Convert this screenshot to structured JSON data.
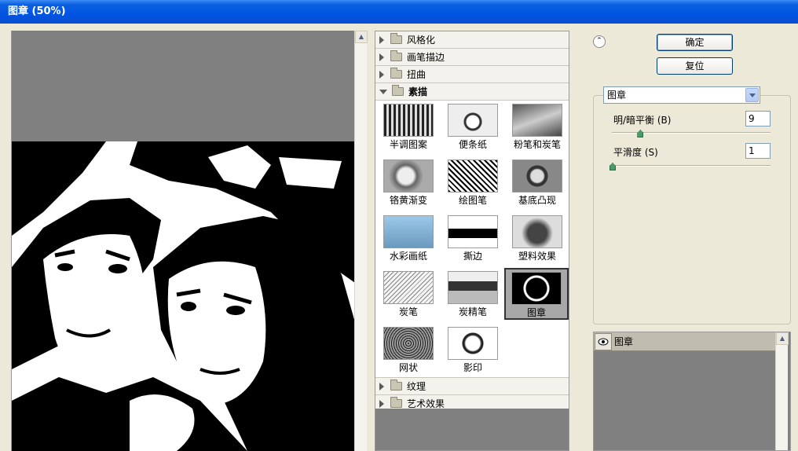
{
  "window": {
    "title": "图章 (50%)"
  },
  "buttons": {
    "ok": "确定",
    "reset": "复位"
  },
  "filter_categories_top": [
    {
      "label": "风格化",
      "expanded": false
    },
    {
      "label": "画笔描边",
      "expanded": false
    },
    {
      "label": "扭曲",
      "expanded": false
    },
    {
      "label": "素描",
      "expanded": true
    }
  ],
  "sketch_filters": [
    {
      "label": "半调图案"
    },
    {
      "label": "便条纸"
    },
    {
      "label": "粉笔和炭笔"
    },
    {
      "label": "铬黄渐变"
    },
    {
      "label": "绘图笔"
    },
    {
      "label": "基底凸现"
    },
    {
      "label": "水彩画纸"
    },
    {
      "label": "撕边"
    },
    {
      "label": "塑料效果"
    },
    {
      "label": "炭笔"
    },
    {
      "label": "炭精笔"
    },
    {
      "label": "图章",
      "selected": true
    },
    {
      "label": "网状"
    },
    {
      "label": "影印"
    }
  ],
  "filter_categories_bottom": [
    {
      "label": "纹理",
      "expanded": false
    },
    {
      "label": "艺术效果",
      "expanded": false
    }
  ],
  "settings": {
    "filter_select": "图章",
    "param1": {
      "label": "明/暗平衡 (B)",
      "value": "9",
      "fraction": 0.18
    },
    "param2": {
      "label": "平滑度 (S)",
      "value": "1",
      "fraction": 0.0
    }
  },
  "layers": [
    {
      "label": "图章"
    }
  ],
  "colors": {
    "title_bar": "#0054E3",
    "dialog_bg": "#ECE9D8",
    "preview_bg": "#808080"
  }
}
